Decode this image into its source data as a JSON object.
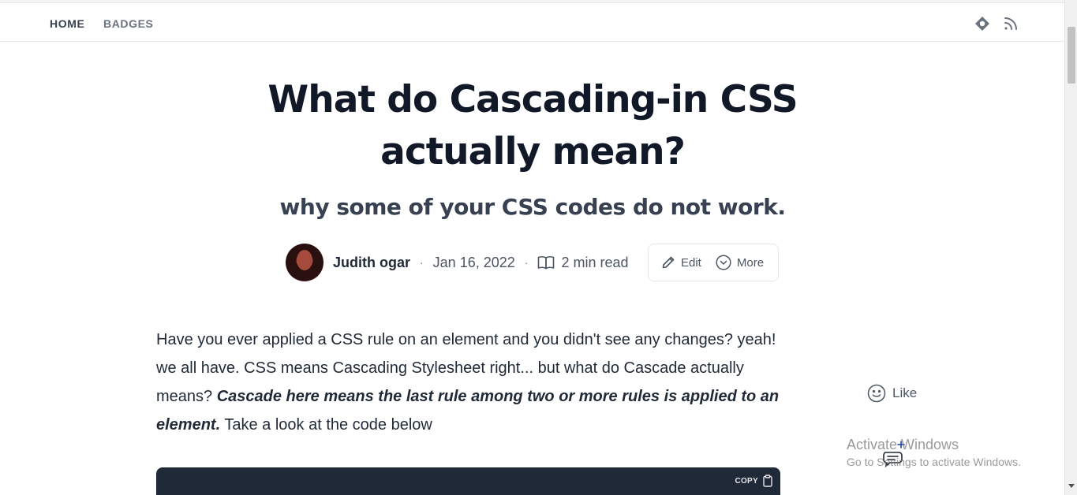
{
  "nav": {
    "home_label": "HOME",
    "badges_label": "BADGES",
    "icons": [
      "hashnode-icon",
      "rss-icon"
    ]
  },
  "article": {
    "title_line1": "What do Cascading-in CSS",
    "title_line2": "actually mean?",
    "subtitle": "why some of your CSS codes do not work.",
    "author": "Judith ogar",
    "date": "Jan 16, 2022",
    "read_time": "2 min read",
    "edit_label": "Edit",
    "more_label": "More",
    "body_part1": "Have you ever applied a CSS rule on an element and you didn't see any changes? yeah! we all have. CSS means Cascading Stylesheet right... but what do Cascade actually means? ",
    "body_emphasis": "Cascade here means the last rule among two or more rules is applied to an element.",
    "body_part2": " Take a look at the code below",
    "copy_label": "COPY"
  },
  "sidebar": {
    "like_label": "Like"
  },
  "watermark": {
    "title": "Activate Windows",
    "subtitle": "Go to Settings to activate Windows."
  },
  "colors": {
    "text_dark": "#111827",
    "text_muted": "#4b5563",
    "code_bg": "#1f2937",
    "border": "#e5e7eb"
  }
}
